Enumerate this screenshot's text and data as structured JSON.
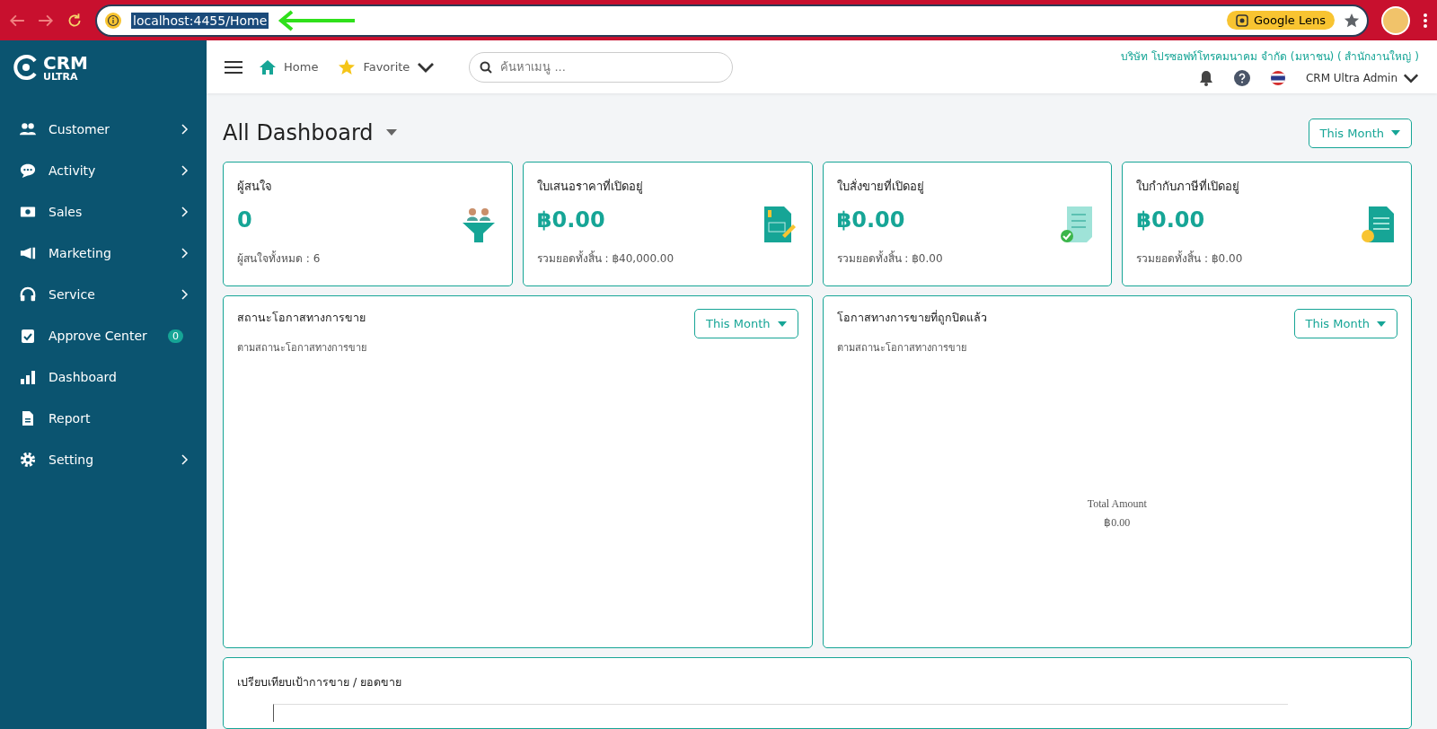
{
  "browser": {
    "address": "localhost:4455/Home",
    "address_selected": true,
    "lens_label": "Google Lens"
  },
  "sidebar": {
    "logo": {
      "line1": "CRM",
      "line2": "ULTRA"
    },
    "items": [
      {
        "label": "Customer",
        "expandable": true
      },
      {
        "label": "Activity",
        "expandable": true
      },
      {
        "label": "Sales",
        "expandable": true
      },
      {
        "label": "Marketing",
        "expandable": true
      },
      {
        "label": "Service",
        "expandable": true
      },
      {
        "label": "Approve Center",
        "expandable": false,
        "badge": "0"
      },
      {
        "label": "Dashboard",
        "expandable": false
      },
      {
        "label": "Report",
        "expandable": false
      },
      {
        "label": "Setting",
        "expandable": true
      }
    ]
  },
  "header": {
    "home": "Home",
    "favorite": "Favorite",
    "search": {
      "placeholder": "ค้นหาเมนู ..."
    },
    "company": "บริษัท โปรซอฟท์โทรคมนาคม จำกัด (มหาชน) ( สำนักงานใหญ่ )",
    "user": "CRM Ultra Admin"
  },
  "page": {
    "title": "All Dashboard",
    "period": "This Month"
  },
  "cards": [
    {
      "title": "ผู้สนใจ",
      "value": "0",
      "footer": "ผู้สนใจทั้งหมด : 6"
    },
    {
      "title": "ใบเสนอราคาที่เปิดอยู่",
      "value": "฿0.00",
      "footer": "รวมยอดทั้งสิ้น : ฿40,000.00"
    },
    {
      "title": "ใบสั่งขายที่เปิดอยู่",
      "value": "฿0.00",
      "footer": "รวมยอดทั้งสิ้น : ฿0.00"
    },
    {
      "title": "ใบกำกับภาษีที่เปิดอยู่",
      "value": "฿0.00",
      "footer": "รวมยอดทั้งสิ้น : ฿0.00"
    }
  ],
  "panels": [
    {
      "title": "สถานะโอกาสทางการขาย",
      "subtitle": "ตามสถานะโอกาสทางการขาย",
      "period": "This Month"
    },
    {
      "title": "โอกาสทางการขายที่ถูกปิดแล้ว",
      "subtitle": "ตามสถานะโอกาสทางการขาย",
      "period": "This Month",
      "center_label": "Total Amount",
      "center_value": "฿0.00"
    }
  ],
  "bottom_panel": {
    "title": "เปรียบเทียบเป้าการขาย / ยอดขาย"
  }
}
